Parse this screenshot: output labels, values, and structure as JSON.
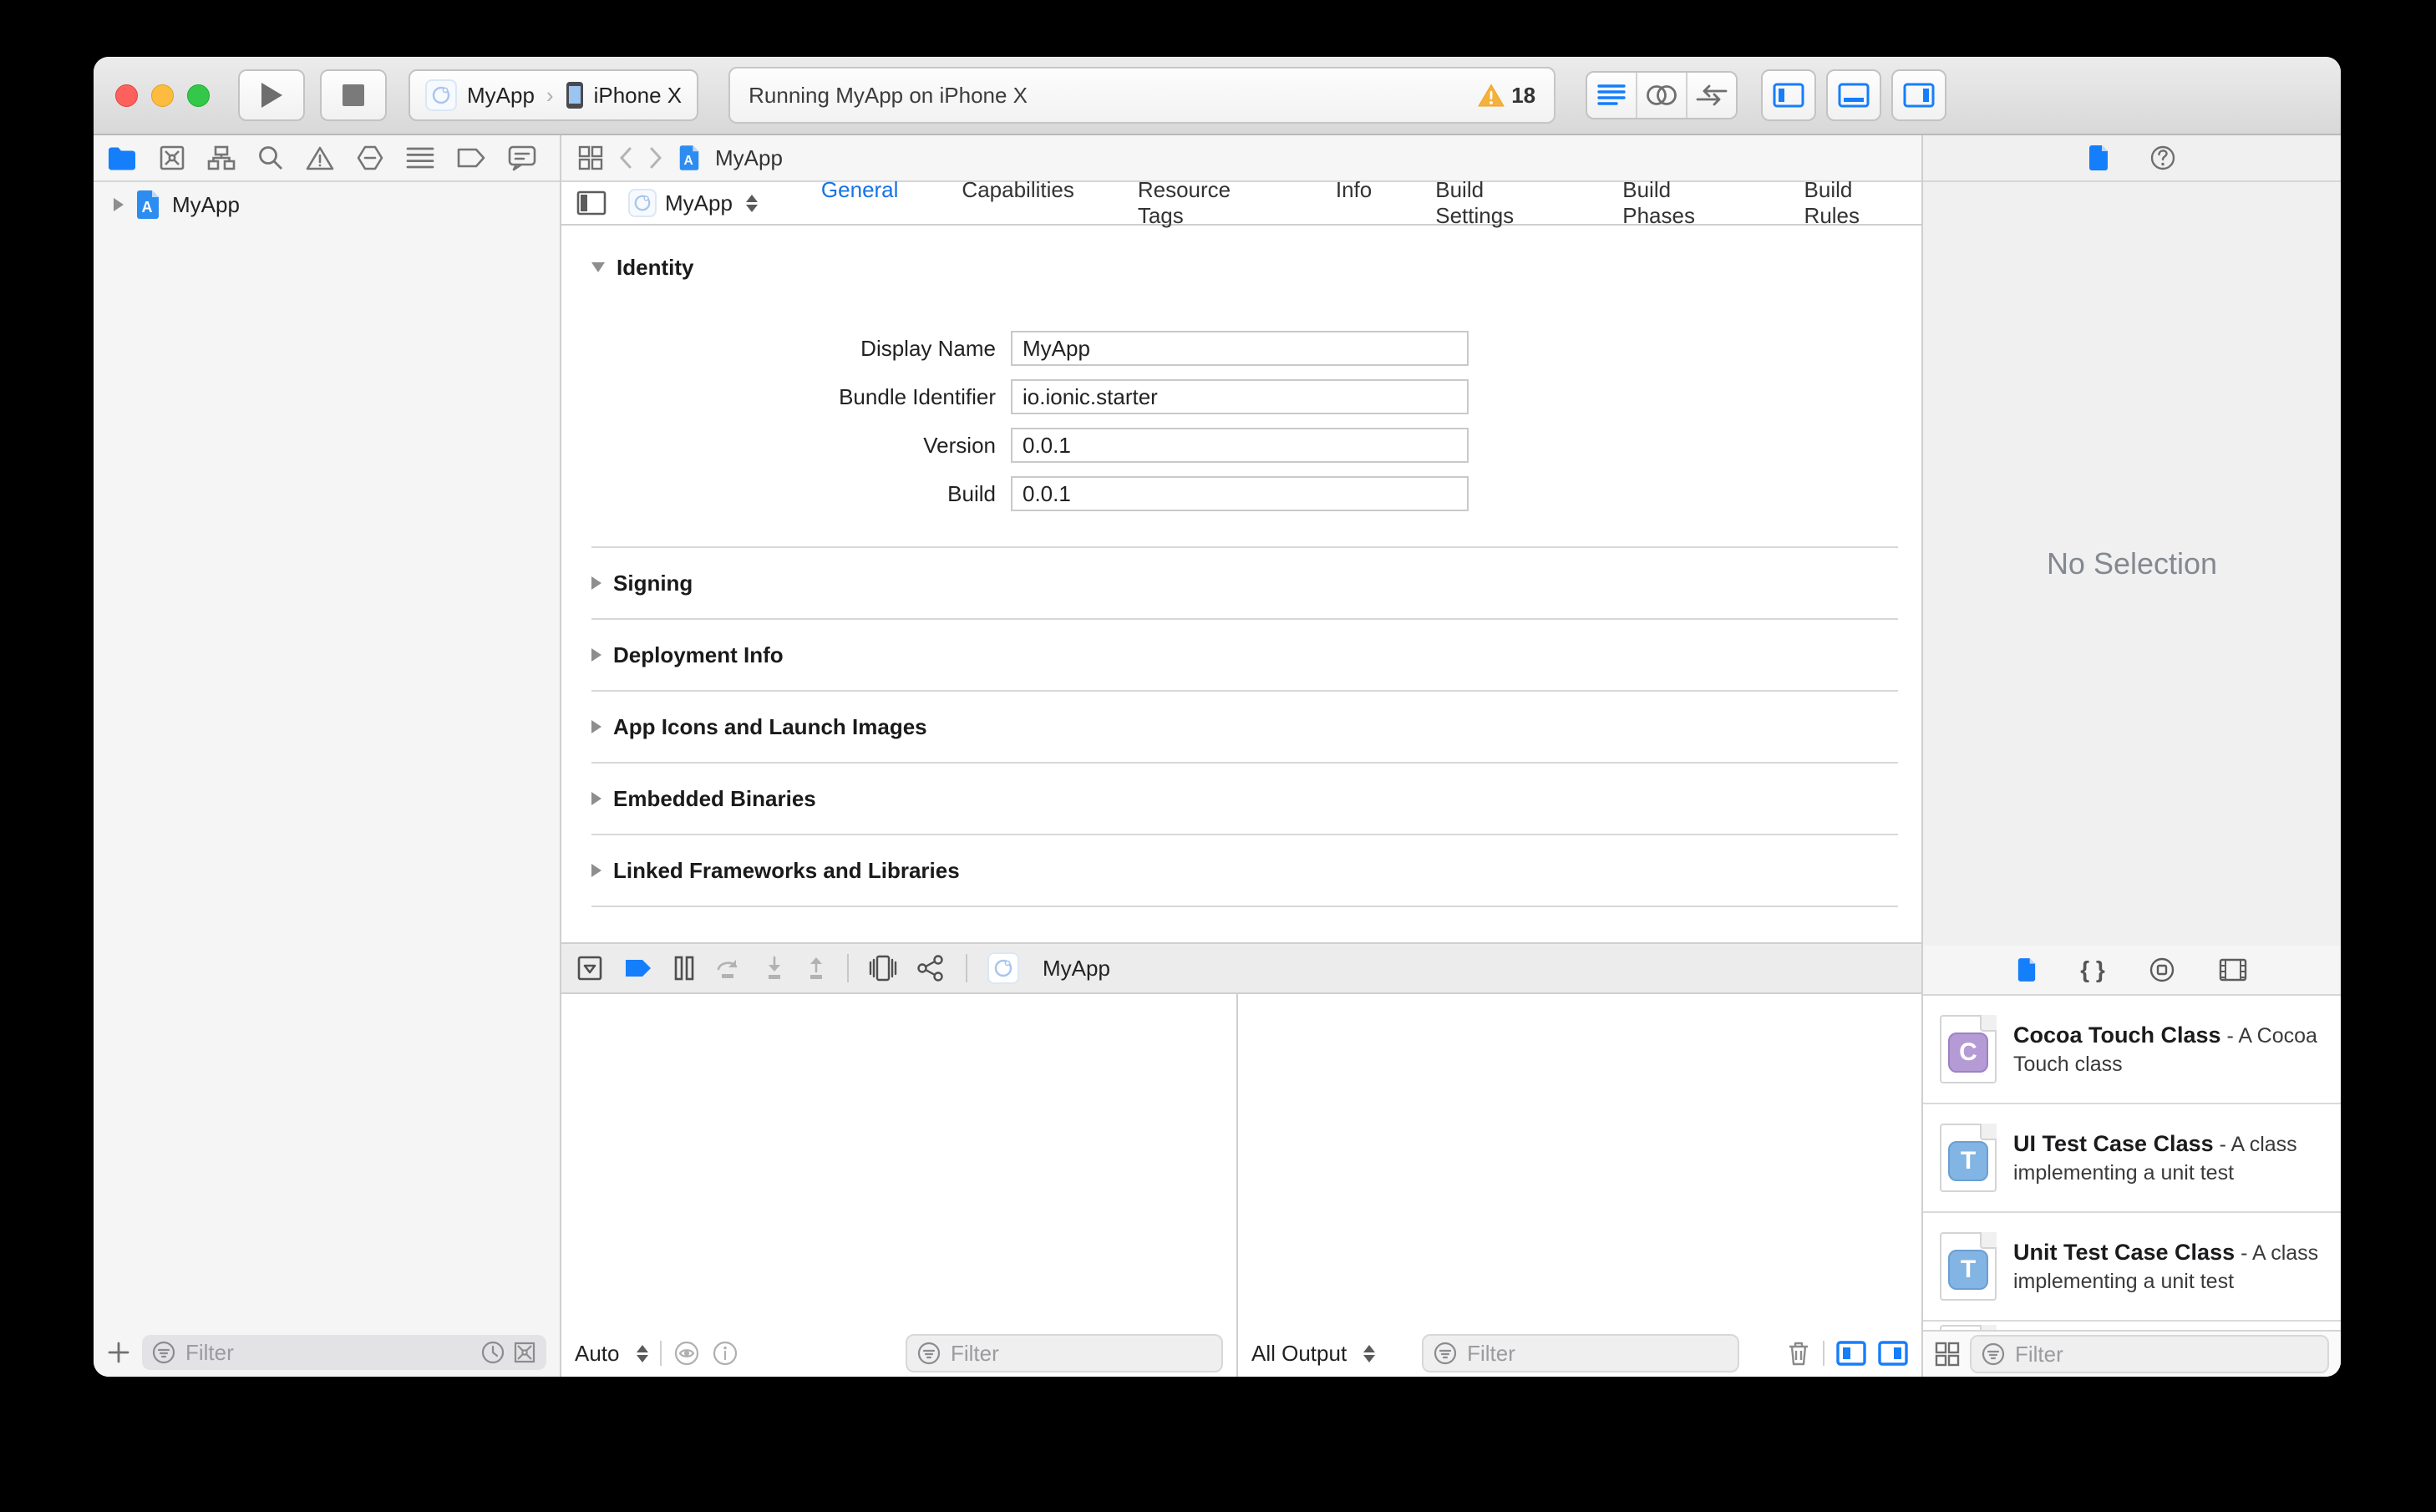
{
  "toolbar": {
    "scheme_target": "MyApp",
    "scheme_separator": "›",
    "scheme_device": "iPhone X",
    "status_message": "Running MyApp on iPhone X",
    "warning_count": "18"
  },
  "navigator": {
    "project_item": "MyApp",
    "filter_placeholder": "Filter"
  },
  "jumpbar": {
    "file": "MyApp"
  },
  "editor": {
    "target": "MyApp",
    "tabs": [
      "General",
      "Capabilities",
      "Resource Tags",
      "Info",
      "Build Settings",
      "Build Phases",
      "Build Rules"
    ],
    "identity": {
      "title": "Identity",
      "rows": [
        {
          "label": "Display Name",
          "value": "MyApp"
        },
        {
          "label": "Bundle Identifier",
          "value": "io.ionic.starter"
        },
        {
          "label": "Version",
          "value": "0.0.1"
        },
        {
          "label": "Build",
          "value": "0.0.1"
        }
      ]
    },
    "sections": [
      {
        "title": "Signing"
      },
      {
        "title": "Deployment Info"
      },
      {
        "title": "App Icons and Launch Images"
      },
      {
        "title": "Embedded Binaries"
      },
      {
        "title": "Linked Frameworks and Libraries"
      }
    ]
  },
  "debug": {
    "app_label": "MyApp",
    "variables_scope": "Auto",
    "console_scope": "All Output",
    "filter_placeholder": "Filter"
  },
  "inspector": {
    "empty_message": "No Selection"
  },
  "library": {
    "items": [
      {
        "name": "Cocoa Touch Class",
        "description": "- A Cocoa Touch class",
        "badge": "C"
      },
      {
        "name": "UI Test Case Class",
        "description": "- A class implementing a unit test",
        "badge": "T"
      },
      {
        "name": "Unit Test Case Class",
        "description": "- A class implementing a unit test",
        "badge": "T"
      }
    ],
    "filter_placeholder": "Filter"
  },
  "colors": {
    "accent": "#157efb",
    "warning": "#f6b13c"
  }
}
